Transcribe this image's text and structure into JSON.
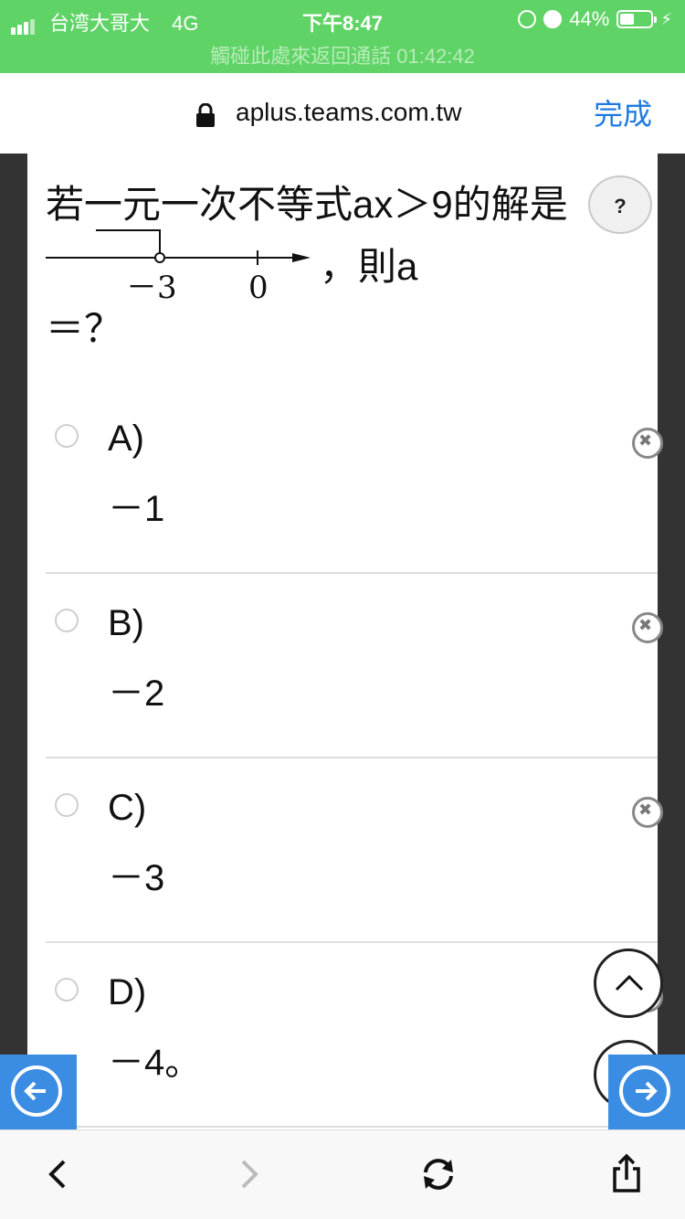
{
  "status": {
    "carrier": "台湾大哥大",
    "network": "4G",
    "time": "下午8:47",
    "battery": "44%",
    "call_banner": "觸碰此處來返回通話 01:42:42"
  },
  "address": {
    "url": "aplus.teams.com.tw",
    "done": "完成"
  },
  "question": {
    "prefix": "若一元一次不等式ax＞9的解是",
    "suffix": "，則a",
    "tail": "＝？",
    "numberline_labels": [
      "－3",
      "0"
    ],
    "help": "?"
  },
  "options": [
    {
      "letter": "A)",
      "value": "－1"
    },
    {
      "letter": "B)",
      "value": "－2"
    },
    {
      "letter": "C)",
      "value": "－3"
    },
    {
      "letter": "D)",
      "value": "－4。"
    }
  ],
  "colors": {
    "status_bg": "#5fd365",
    "accent": "#1f7ae0",
    "nav_blue": "#3b8ce3",
    "side_bg": "#333333"
  },
  "icons": [
    "lock-icon",
    "help-icon",
    "remove-option-icon",
    "scroll-up-icon",
    "arrow-left-circle-icon",
    "arrow-right-circle-icon",
    "back-icon",
    "forward-icon",
    "reload-icon",
    "share-icon"
  ]
}
